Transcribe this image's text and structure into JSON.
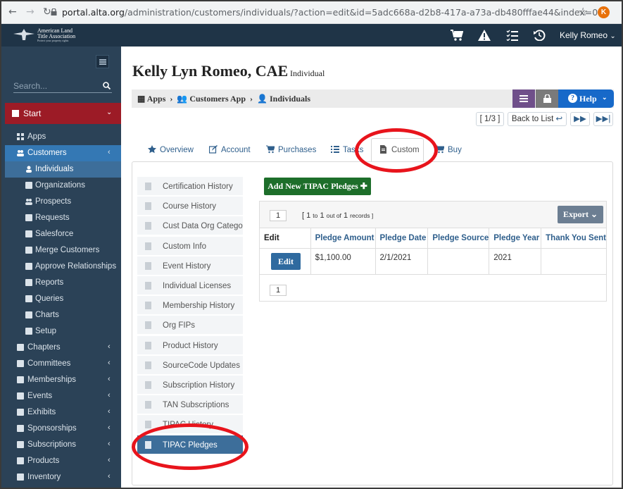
{
  "browser": {
    "url_host": "portal.alta.org",
    "url_path": "/administration/customers/individuals/?action=edit&id=5adc668a-d2b8-417a-a73a-db480fffae44&index=0",
    "profile_initial": "K"
  },
  "topbar": {
    "logo_line1": "American Land",
    "logo_line2": "Title Association",
    "logo_tagline": "Protect your property rights",
    "user_name": "Kelly Romeo",
    "icons": [
      "cart-icon",
      "warning-icon",
      "tasks-icon",
      "history-icon"
    ]
  },
  "sidebar": {
    "search_placeholder": "Search...",
    "start_label": "Start",
    "items": [
      {
        "label": "Apps",
        "icon": "apps-icon",
        "level": 0
      },
      {
        "label": "Customers",
        "icon": "users-icon",
        "level": 0,
        "active": true
      },
      {
        "label": "Individuals",
        "icon": "user-icon",
        "level": 1,
        "selected": true
      },
      {
        "label": "Organizations",
        "icon": "building-icon",
        "level": 1
      },
      {
        "label": "Prospects",
        "icon": "users-icon",
        "level": 1
      },
      {
        "label": "Requests",
        "icon": "gear-icon",
        "level": 1
      },
      {
        "label": "Salesforce",
        "icon": "cloud-icon",
        "level": 1
      },
      {
        "label": "Merge Customers",
        "icon": "exchange-icon",
        "level": 1
      },
      {
        "label": "Approve Relationships",
        "icon": "check-square-icon",
        "level": 1
      },
      {
        "label": "Reports",
        "icon": "area-chart-icon",
        "level": 1
      },
      {
        "label": "Queries",
        "icon": "table-icon",
        "level": 1
      },
      {
        "label": "Charts",
        "icon": "line-chart-icon",
        "level": 1
      },
      {
        "label": "Setup",
        "icon": "list-icon",
        "level": 1
      },
      {
        "label": "Chapters",
        "icon": "archive-icon",
        "level": 0
      },
      {
        "label": "Committees",
        "icon": "briefcase-icon",
        "level": 0
      },
      {
        "label": "Memberships",
        "icon": "bookmark-icon",
        "level": 0
      },
      {
        "label": "Events",
        "icon": "calendar-icon",
        "level": 0
      },
      {
        "label": "Exhibits",
        "icon": "grid-icon",
        "level": 0
      },
      {
        "label": "Sponsorships",
        "icon": "star-icon",
        "level": 0
      },
      {
        "label": "Subscriptions",
        "icon": "hdd-icon",
        "level": 0
      },
      {
        "label": "Products",
        "icon": "barcode-icon",
        "level": 0
      },
      {
        "label": "Inventory",
        "icon": "industry-icon",
        "level": 0
      }
    ]
  },
  "header": {
    "name": "Kelly Lyn Romeo, CAE",
    "type": "Individual"
  },
  "breadcrumb": {
    "apps": "Apps",
    "customers_app": "Customers App",
    "individuals": "Individuals",
    "help": "Help"
  },
  "pager": {
    "position": "[ 1/3 ]",
    "back": "Back to List"
  },
  "tabs": [
    {
      "label": "Overview",
      "icon": "star-icon"
    },
    {
      "label": "Account",
      "icon": "edit-icon"
    },
    {
      "label": "Purchases",
      "icon": "cart-icon"
    },
    {
      "label": "Tasks",
      "icon": "tasks-icon"
    },
    {
      "label": "Custom",
      "icon": "file-icon",
      "active": true
    },
    {
      "label": "Buy",
      "icon": "cart-icon"
    }
  ],
  "custom_nav": [
    "Certification History",
    "Course History",
    "Cust Data Org Categories",
    "Custom Info",
    "Event History",
    "Individual Licenses",
    "Membership History",
    "Org FIPs",
    "Product History",
    "SourceCode Updates",
    "Subscription History",
    "TAN Subscriptions",
    "TIPAC History",
    "TIPAC Pledges"
  ],
  "custom_nav_selected": 13,
  "content": {
    "add_button": "Add New TIPAC Pledges",
    "page_number": "1",
    "records_prefix": "[ 1",
    "records_to": "to",
    "records_mid": "1",
    "records_outof": "out of",
    "records_total": "1",
    "records_suffix": "records ]",
    "export": "Export",
    "columns": [
      "Edit",
      "Pledge Amount",
      "Pledge Date",
      "Pledge Source",
      "Pledge Year",
      "Thank You Sent"
    ],
    "rows": [
      {
        "edit": "Edit",
        "amount": "$1,100.00",
        "date": "2/1/2021",
        "source": "",
        "year": "2021",
        "thanks": ""
      }
    ],
    "bottom_page": "1"
  },
  "colors": {
    "sidebar": "#2b4257",
    "topbar": "#1f3447",
    "start": "#9c1b26",
    "add_button": "#1d6e2a",
    "highlight_ring": "#e8141c"
  }
}
